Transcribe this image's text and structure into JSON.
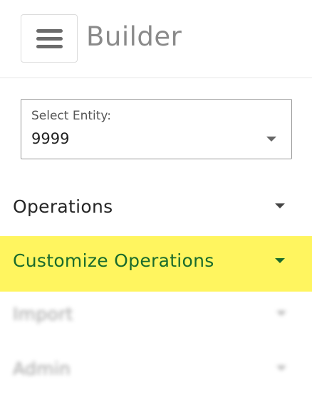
{
  "header": {
    "menu_icon": "hamburger-menu-icon",
    "title": "Builder"
  },
  "entity_select": {
    "label": "Select Entity:",
    "value": "9999",
    "icon": "caret-down-icon"
  },
  "nav": {
    "items": [
      {
        "label": "Operations",
        "icon": "caret-down-icon",
        "highlighted": false,
        "blurred": false
      },
      {
        "label": "Customize Operations",
        "icon": "caret-down-icon",
        "highlighted": true,
        "blurred": false
      },
      {
        "label": "Import",
        "icon": "caret-down-icon",
        "highlighted": false,
        "blurred": true
      },
      {
        "label": "Admin",
        "icon": "caret-down-icon",
        "highlighted": false,
        "blurred": true
      }
    ]
  },
  "colors": {
    "highlight_bg": "#fff55f",
    "highlight_text": "#1a6b2c",
    "title_text": "#8a8a8a"
  }
}
